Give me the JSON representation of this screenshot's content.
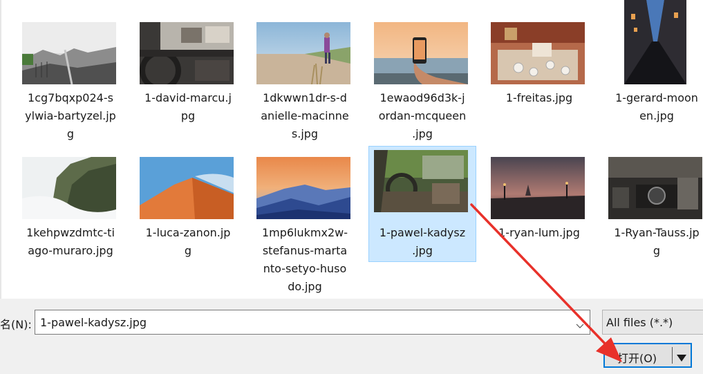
{
  "files": [
    {
      "name": "1cg7bqxp024-s\nylwia-bartyzel.jp\ng",
      "thumb": "mountain-bw"
    },
    {
      "name": "1-david-marcu.j\npg",
      "thumb": "car-interior"
    },
    {
      "name": "1dkwwn1dr-s-d\nanielle-macinne\ns.jpg",
      "thumb": "beach-person"
    },
    {
      "name": "1ewaod96d3k-j\nordan-mcqueen\n.jpg",
      "thumb": "phone-sunset"
    },
    {
      "name": "1-freitas.jpg",
      "thumb": "cafe-table"
    },
    {
      "name": "1-gerard-moon\nen.jpg",
      "thumb": "city-street"
    },
    {
      "name": "1kehpwzdmtc-ti\nago-muraro.jpg",
      "thumb": "cliff-fog"
    },
    {
      "name": "1-luca-zanon.jp\ng",
      "thumb": "desert-dune"
    },
    {
      "name": "1mp6lukmx2w-\nstefanus-marta\nnto-setyo-huso\ndo.jpg",
      "thumb": "blue-mountains"
    },
    {
      "name": "1-pawel-kadysz\n.jpg",
      "thumb": "abandoned-car",
      "selected": true
    },
    {
      "name": "1-ryan-lum.jpg",
      "thumb": "bridge-dusk"
    },
    {
      "name": "1-Ryan-Tauss.jp\ng",
      "thumb": "camera-gear"
    }
  ],
  "bottom": {
    "filename_label": "名(N):",
    "filename_value": "1-pawel-kadysz.jpg",
    "filter_value": "All files (*.*)",
    "open_label": "打开(O)"
  },
  "icons": {
    "filename_dropdown": "chevron-down-icon",
    "open_dropdown": "triangle-down-icon"
  },
  "colors": {
    "selection_bg": "#cce8ff",
    "selection_border": "#99d1ff",
    "button_focus": "#0078d7",
    "annotation_arrow": "#e8312a"
  }
}
